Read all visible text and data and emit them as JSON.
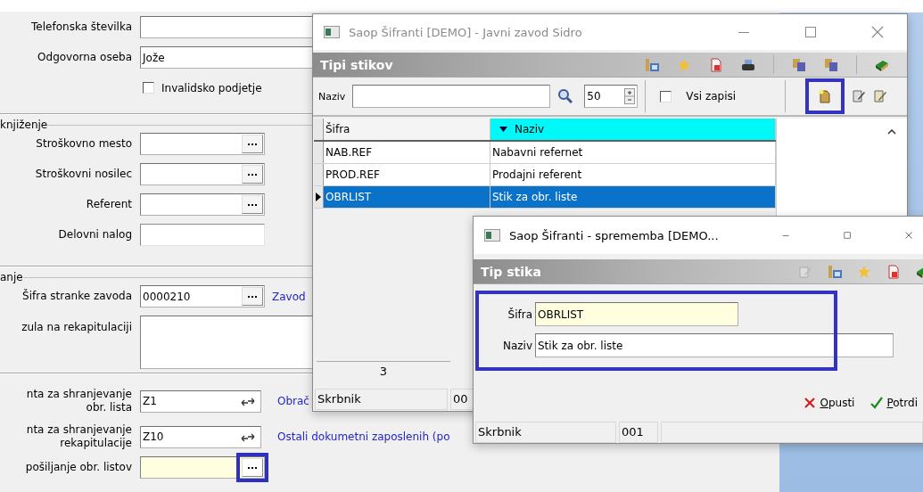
{
  "form": {
    "rows": [
      {
        "kind": "field",
        "label": "Telefonska številka"
      },
      {
        "kind": "field",
        "label": "Odgovorna oseba",
        "value": "Jože"
      },
      {
        "kind": "checkbox",
        "label": "Invalidsko podjetje",
        "checked": false
      },
      {
        "kind": "section",
        "label": "knjiženje"
      },
      {
        "kind": "lookup",
        "label": "Stroškovno mesto"
      },
      {
        "kind": "lookup",
        "label": "Stroškovni nosilec"
      },
      {
        "kind": "lookup",
        "label": "Referent"
      },
      {
        "kind": "short",
        "label": "Delovni nalog"
      },
      {
        "kind": "section",
        "label": "anje"
      },
      {
        "kind": "lookup",
        "label": "Šifra stranke zavoda",
        "value": "0000210",
        "link": "Zavod"
      },
      {
        "kind": "textarea",
        "label": "zula na rekapitulaciji"
      },
      {
        "kind": "divider"
      },
      {
        "kind": "swap",
        "label": "nta za shranjevanje",
        "label_2": "obr. lista",
        "value": "Z1",
        "link": "Obrač"
      },
      {
        "kind": "swap",
        "label": "nta za shranjevanje",
        "label_2": "rekapitulacije",
        "value": "Z10",
        "link": "Ostali dokumetni zaposlenih (po"
      },
      {
        "kind": "lookup",
        "label": "pošiljanje obr. listov",
        "focused": true,
        "highlighted": true
      }
    ]
  },
  "list_window": {
    "title": "Saop Šifranti [DEMO] - Javni zavod Sidro",
    "header": "Tipi stikov",
    "search": {
      "label": "Naziv",
      "limit": "50",
      "all_records": {
        "label": "Vsi zapisi",
        "checked": false
      }
    },
    "new_record_highlighted": true,
    "columns": [
      {
        "label": "Šifra",
        "sorted": false
      },
      {
        "label": "Naziv",
        "sorted": true
      }
    ],
    "rows": [
      {
        "cells": [
          "NAB.REF",
          "Nabavni refernet"
        ],
        "selected": false
      },
      {
        "cells": [
          "PROD.REF",
          "Prodajni referent"
        ],
        "selected": false
      },
      {
        "cells": [
          "OBRLIST",
          "Stik za obr. liste"
        ],
        "selected": true
      }
    ],
    "record_count": "3",
    "status": [
      "Skrbnik",
      "00"
    ]
  },
  "edit_window": {
    "title": "Saop Šifranti - sprememba [DEMO...",
    "header": "Tip stika",
    "fields_highlighted": true,
    "fields": [
      {
        "label": "Šifra",
        "value": "OBRLIST",
        "focused": true
      },
      {
        "label": "Naziv",
        "value": "Stik za obr. liste",
        "focused": false
      }
    ],
    "buttons": [
      {
        "kind": "cancel",
        "label": "Opusti"
      },
      {
        "kind": "confirm",
        "label": "Potrdi"
      }
    ],
    "status": [
      "Skrbnik",
      "001"
    ]
  }
}
